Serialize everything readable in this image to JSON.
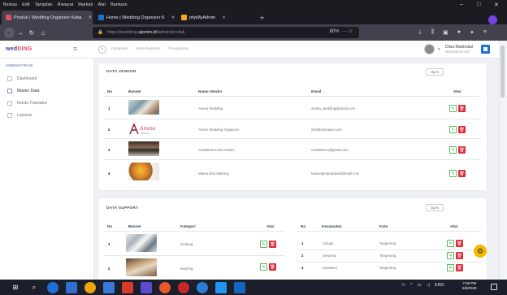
{
  "browser": {
    "menu": [
      "Berkas",
      "Edit",
      "Tampilan",
      "Riwayat",
      "Markah",
      "Alat",
      "Bantuan"
    ],
    "tabs": [
      {
        "label": "Produk | Wedding Organizer Kaba",
        "fav_color": "#e24f63",
        "active": true
      },
      {
        "label": "Home | Wedding Organizer K",
        "fav_color": "#1e6fd9",
        "active": false
      },
      {
        "label": "phpMyAdmin",
        "fav_color": "#f5a623",
        "active": false
      }
    ],
    "tab_close": "✕",
    "tab_new": "+",
    "url_prefix": "https://wedding.",
    "url_host": "ajomm.id",
    "url_path": "/admin/produk",
    "zoom": "80%",
    "window_controls": [
      "–",
      "□",
      "✕"
    ]
  },
  "header": {
    "logo_a": "wed",
    "logo_b": "DING",
    "links": [
      "Database",
      "Detail kalkkan",
      "Pengaturan"
    ],
    "user_name": "Diisa Madinatul",
    "user_email": "diisa@ama.com"
  },
  "sidebar": {
    "heading": "ADMINISTRASI",
    "items": [
      {
        "label": "Dashboard",
        "active": false
      },
      {
        "label": "Master Data",
        "active": true
      },
      {
        "label": "Kelola Transaksi",
        "active": false
      },
      {
        "label": "Laporan",
        "active": false
      }
    ]
  },
  "vendor_card": {
    "title": "DATA VENDOR",
    "open_label": "Open",
    "headers": [
      "No",
      "Banner",
      "Nama Vendor",
      "Email",
      "Aksi"
    ],
    "rows": [
      {
        "no": "1",
        "name": "Amina Wedding",
        "email": "amina_wedding@gmail.com"
      },
      {
        "no": "2",
        "name": "Amine Wedding Organizer",
        "email": "info@aminawo.com"
      },
      {
        "no": "3",
        "name": "Casablanca Decoration",
        "email": "casablanca@gmail.com"
      },
      {
        "no": "4",
        "name": "Mama dina katering",
        "email": "kateringmamadina@email.com"
      }
    ]
  },
  "support_card": {
    "title": "DATA SUPPORT",
    "open_label": "Open",
    "left_headers": [
      "No",
      "Banner",
      "Kategori",
      "Aksi"
    ],
    "right_headers": [
      "No",
      "Kecamatan",
      "Kota",
      "Aksi"
    ],
    "left_rows": [
      {
        "no": "1",
        "category": "Gedung"
      },
      {
        "no": "2",
        "category": "katering"
      }
    ],
    "right_rows": [
      {
        "no": "1",
        "district": "Cikupa",
        "city": "Tangerang"
      },
      {
        "no": "2",
        "district": "Serpong",
        "city": "Tangerang"
      },
      {
        "no": "3",
        "district": "Karawaci",
        "city": "Tangerang"
      }
    ]
  },
  "icons": {
    "edit": "✎",
    "delete": "🗑",
    "gear": "⚙"
  },
  "taskbar": {
    "clock_time": "7:09 PM",
    "clock_date": "6/5/2020",
    "tray": [
      "^",
      "ENG"
    ]
  }
}
